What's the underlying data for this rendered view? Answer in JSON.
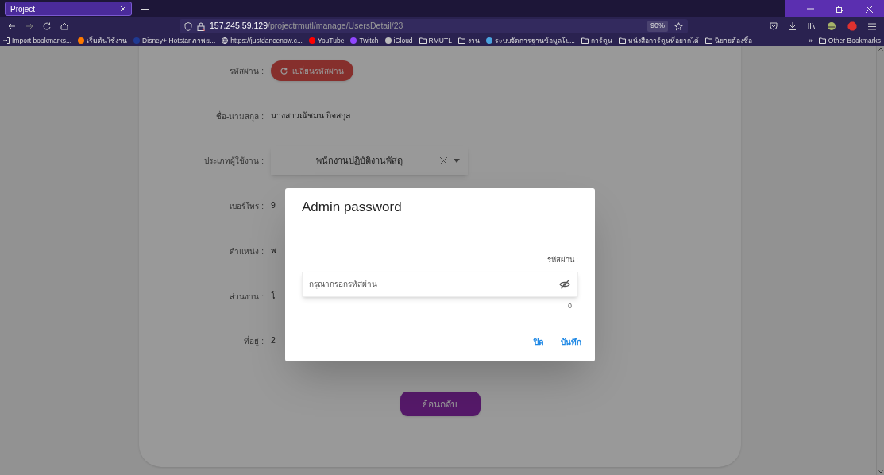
{
  "browser": {
    "tab": {
      "title": "Project",
      "selected": true
    },
    "address": {
      "host": "157.245.59.129",
      "path": "/projectrmutl/manage/UsersDetail/23"
    },
    "zoom": "90%",
    "bookmarks": [
      {
        "kind": "import",
        "label": "Import bookmarks..."
      },
      {
        "kind": "site",
        "label": "เริ่มต้นใช้งาน",
        "color": "#ff7a00"
      },
      {
        "kind": "site",
        "label": "Disney+ Hotstar ภาพย...",
        "color": "#1f3a93"
      },
      {
        "kind": "globe",
        "label": "https://justdancenow.c..."
      },
      {
        "kind": "site",
        "label": "YouTube",
        "color": "#ff0000"
      },
      {
        "kind": "site",
        "label": "Twitch",
        "color": "#9146ff"
      },
      {
        "kind": "site",
        "label": "iCloud",
        "color": "#bbbbbb"
      },
      {
        "kind": "folder",
        "label": "RMUTL"
      },
      {
        "kind": "folder",
        "label": "งาน"
      },
      {
        "kind": "site",
        "label": "ระบบจัดการฐานข้อมูลโป...",
        "color": "#4aa3df"
      },
      {
        "kind": "folder",
        "label": "การ์ตูน"
      },
      {
        "kind": "folder",
        "label": "หนังสือการ์ตูนที่อยากได้"
      },
      {
        "kind": "folder",
        "label": "นิยายต้องซื้อ"
      }
    ],
    "overflow": "»",
    "other_bookmarks": "Other Bookmarks"
  },
  "form": {
    "rows": [
      {
        "kind": "button",
        "label": "รหัสผ่าน :",
        "value": "เปลี่ยนรหัสผ่าน"
      },
      {
        "kind": "text",
        "label": "ชื่อ-นามสกุล :",
        "value": "นางสาวณัชมน กิจสกุล"
      },
      {
        "kind": "select",
        "label": "ประเภทผู้ใช้งาน :",
        "value": "พนักงานปฏิบัติงานพัสดุ"
      },
      {
        "kind": "text",
        "label": "เบอร์โทร :",
        "value": "9"
      },
      {
        "kind": "text",
        "label": "ตำแหน่ง :",
        "value": "พ"
      },
      {
        "kind": "text",
        "label": "ส่วนงาน :",
        "value": "โ"
      },
      {
        "kind": "text",
        "label": "ที่อยู่ :",
        "value": "2"
      }
    ],
    "back_button": "ย้อนกลับ"
  },
  "dialog": {
    "title": "Admin password",
    "field_label": "รหัสผ่าน :",
    "placeholder": "กรุณากรอกรหัสผ่าน",
    "counter": "0",
    "buttons": [
      "ปิด",
      "บันทึก"
    ]
  }
}
